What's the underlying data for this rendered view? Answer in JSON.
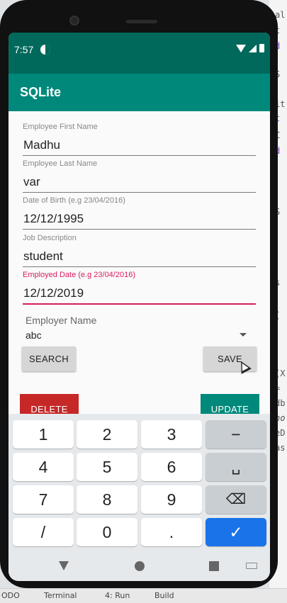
{
  "status_bar": {
    "time": "7:57"
  },
  "app_bar": {
    "title": "SQLite"
  },
  "form": {
    "first_name": {
      "label": "Employee First Name",
      "value": "Madhu"
    },
    "last_name": {
      "label": "Employee Last Name",
      "value": "var"
    },
    "dob": {
      "label": "Date of Birth (e.g 23/04/2016)",
      "value": "12/12/1995"
    },
    "job": {
      "label": "Job Description",
      "value": "student"
    },
    "employed": {
      "label": "Employed Date (e.g 23/04/2016)",
      "value": "12/12/2019"
    },
    "employer": {
      "label": "Employer Name",
      "value": "abc"
    }
  },
  "buttons": {
    "search": "SEARCH",
    "save": "SAVE",
    "delete": "DELETE",
    "update": "UPDATE"
  },
  "keyboard": {
    "keys": [
      "1",
      "2",
      "3",
      "−",
      "4",
      "5",
      "6",
      "␣",
      "7",
      "8",
      "9",
      "⌫",
      "/",
      "0",
      ".",
      "✓"
    ]
  },
  "ide": {
    "bottom_items": [
      "ODO",
      "Terminal",
      "4: Run",
      "Build"
    ],
    "code_chars": [
      "al",
      "t",
      "d",
      "S",
      "it",
      "t",
      "C",
      "d",
      "S",
      "s",
      "(",
      "(X",
      "=",
      "db",
      "ho",
      "eD",
      "as"
    ]
  },
  "colors": {
    "primary": "#00897b",
    "primary_dark": "#00695c",
    "accent": "#d81b60",
    "delete": "#c62828",
    "keyboard_action": "#1a73e8"
  }
}
